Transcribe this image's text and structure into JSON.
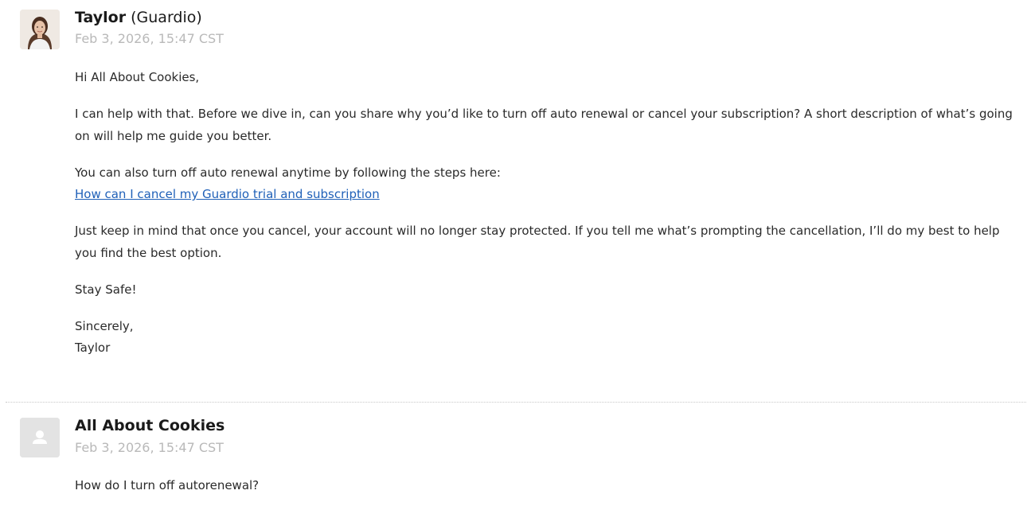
{
  "comments": [
    {
      "author_name": "Taylor",
      "author_org": "(Guardio)",
      "timestamp": "Feb 3, 2026, 15:47 CST",
      "avatar": "agent-photo",
      "greeting": "Hi All About Cookies,",
      "paragraph_1": "I can help with that. Before we dive in, can you share why you’d like to turn off auto renewal or cancel your subscription? A short description of what’s going on will help me guide you better.",
      "paragraph_2_intro": "You can also turn off auto renewal anytime by following the steps here:",
      "help_link": "How can I cancel my Guardio trial and subscription",
      "paragraph_3": "Just keep in mind that once you cancel, your account will no longer stay protected. If you tell me what’s prompting the cancellation, I’ll do my best to help you find the best option.",
      "sign_off_1": "Stay Safe!",
      "sign_off_2": "Sincerely,",
      "signature": "Taylor"
    },
    {
      "author_name": "All About Cookies",
      "timestamp": "Feb 3, 2026, 15:47 CST",
      "avatar": "default-user-icon",
      "message": "How do I turn off autorenewal?"
    }
  ],
  "colors": {
    "link": "#1f60b8",
    "timestamp": "#b9b9b9",
    "divider": "#c8c8c8"
  }
}
